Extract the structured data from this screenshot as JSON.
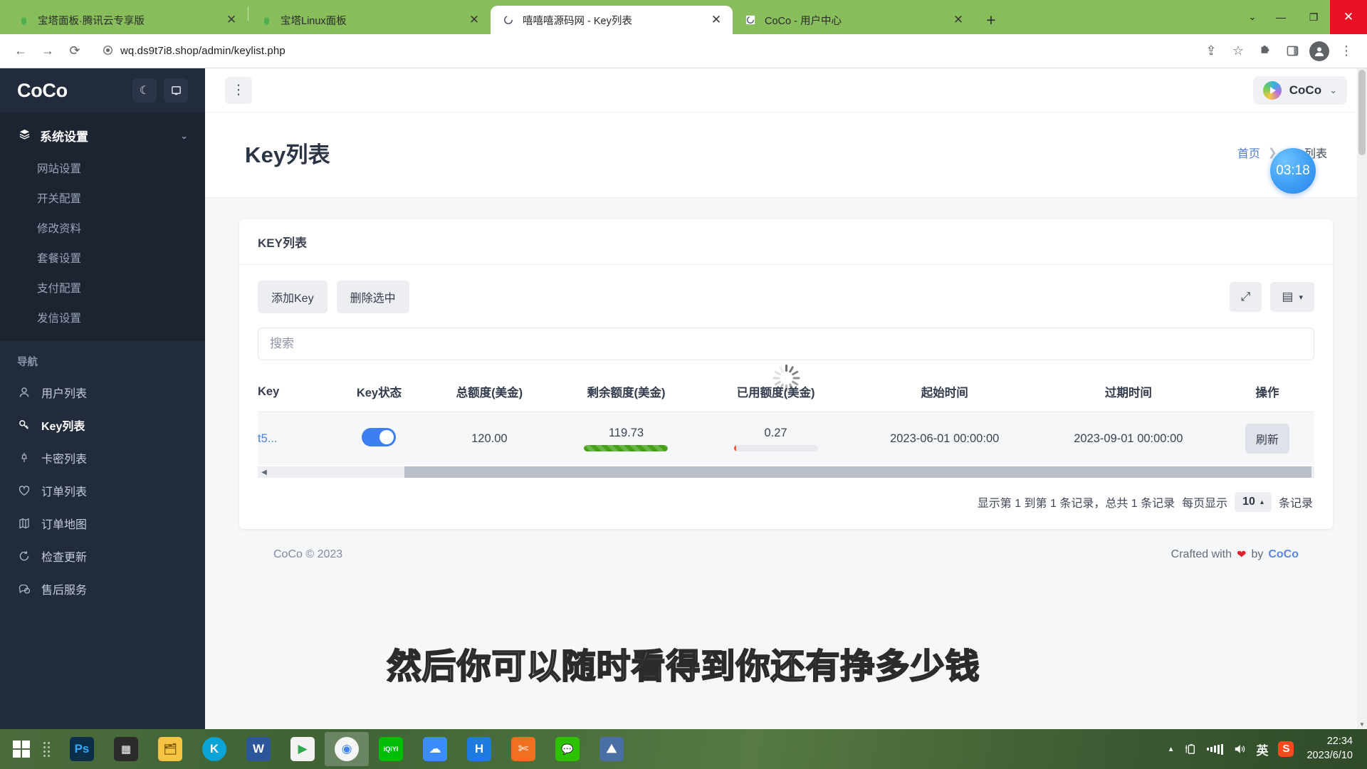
{
  "browser": {
    "tabs": [
      {
        "title": "宝塔面板·腾讯云专享版",
        "favicon": "bt-panel-icon",
        "active": false
      },
      {
        "title": "宝塔Linux面板",
        "favicon": "bt-panel-icon",
        "active": false
      },
      {
        "title": "嘻嘻嘻源码网 - Key列表",
        "favicon": "loading-icon",
        "active": true
      },
      {
        "title": "CoCo - 用户中心",
        "favicon": "loading-icon",
        "active": false
      }
    ],
    "new_tab_label": "+",
    "tab_close_label": "✕",
    "tab_list_chevron": "⌄",
    "window_minimize": "—",
    "window_maximize": "❐",
    "window_close": "✕",
    "nav": {
      "back": "←",
      "forward": "→",
      "reload": "⟳",
      "lock_icon": "●",
      "url": "wq.ds9t7i8.shop/admin/keylist.php",
      "share_icon": "⇪",
      "bookmark_icon": "☆",
      "extensions_icon": "🧩",
      "sidepanel_icon": "▯",
      "profile_icon": "👤",
      "menu_icon": "⋮"
    }
  },
  "sidebar": {
    "brand": "CoCo",
    "theme_toggle_icon": "☾",
    "layout_toggle_icon": "▣",
    "group": {
      "label": "系统设置",
      "icon": "layers-icon",
      "caret": "⌄",
      "items": [
        {
          "label": "网站设置"
        },
        {
          "label": "开关配置"
        },
        {
          "label": "修改资料"
        },
        {
          "label": "套餐设置"
        },
        {
          "label": "支付配置"
        },
        {
          "label": "发信设置"
        }
      ]
    },
    "nav_label": "导航",
    "nav_items": [
      {
        "label": "用户列表",
        "icon": "user-icon",
        "active": false
      },
      {
        "label": "Key列表",
        "icon": "key-icon",
        "active": true
      },
      {
        "label": "卡密列表",
        "icon": "pin-icon",
        "active": false
      },
      {
        "label": "订单列表",
        "icon": "heart-icon",
        "active": false
      },
      {
        "label": "订单地图",
        "icon": "map-icon",
        "active": false
      },
      {
        "label": "检查更新",
        "icon": "refresh-circle-icon",
        "active": false
      },
      {
        "label": "售后服务",
        "icon": "chat-icon",
        "active": false
      }
    ]
  },
  "topbar": {
    "kebab_icon": "⋮",
    "user_name": "CoCo",
    "user_caret": "⌄"
  },
  "page": {
    "title": "Key列表",
    "breadcrumb_home": "首页",
    "breadcrumb_sep": "❯",
    "breadcrumb_current": "Key列表",
    "float_badge": "03:18"
  },
  "card": {
    "title": "KEY列表",
    "buttons": {
      "add_key": "添加Key",
      "delete_selected": "删除选中"
    },
    "fullscreen_icon": "⤢",
    "columns_icon": "▤",
    "columns_caret": "▾",
    "search_placeholder": "搜索"
  },
  "table": {
    "columns": [
      "Key",
      "Key状态",
      "总额度(美金)",
      "剩余额度(美金)",
      "已用额度(美金)",
      "起始时间",
      "过期时间",
      "操作"
    ],
    "rows": [
      {
        "key": "t5...",
        "status_on": true,
        "total": "120.00",
        "remaining": "119.73",
        "remaining_pct": 100,
        "used": "0.27",
        "used_pct": 2,
        "start_time": "2023-06-01 00:00:00",
        "expire_time": "2023-09-01 00:00:00",
        "action": "刷新"
      }
    ],
    "scroll_left_arrow": "◀",
    "scroll_right_arrow": "▶"
  },
  "pagination": {
    "summary": "显示第 1 到第 1 条记录，总共 1 条记录",
    "per_page_label": "每页显示",
    "per_page_value": "10",
    "per_page_caret": "▴",
    "records_suffix": "条记录"
  },
  "footer": {
    "copyright": "CoCo © 2023",
    "crafted_prefix": "Crafted with",
    "heart": "❤",
    "crafted_by": "by",
    "crafted_author": "CoCo"
  },
  "subtitle": "然后你可以随时看得到你还有挣多少钱",
  "taskbar": {
    "apps": [
      {
        "name": "photoshop",
        "label": "Ps",
        "color": "#0b2f4a",
        "text_color": "#31a8ff",
        "selected": false
      },
      {
        "name": "editor",
        "label": "▦",
        "color": "#2b2b2b",
        "text_color": "#ffffff",
        "selected": false
      },
      {
        "name": "file-explorer",
        "label": "🗂",
        "color": "#f6c343",
        "text_color": "#7a5a00",
        "selected": false
      },
      {
        "name": "kugou",
        "label": "K",
        "color": "#0aa4d6",
        "text_color": "#ffffff",
        "selected": false
      },
      {
        "name": "word",
        "label": "W",
        "color": "#2b579a",
        "text_color": "#ffffff",
        "selected": false
      },
      {
        "name": "media-player",
        "label": "▶",
        "color": "#f2f2f2",
        "text_color": "#2fa84f",
        "selected": false
      },
      {
        "name": "chrome",
        "label": "◉",
        "color": "#f5f5f5",
        "text_color": "#4285f4",
        "selected": true
      },
      {
        "name": "iqiyi",
        "label": "iQIYI",
        "color": "#00be06",
        "text_color": "#ffffff",
        "selected": false
      },
      {
        "name": "baidu-netdisk",
        "label": "☁",
        "color": "#3b8cff",
        "text_color": "#ffffff",
        "selected": false
      },
      {
        "name": "huorong",
        "label": "H",
        "color": "#1f7ae0",
        "text_color": "#ffffff",
        "selected": false
      },
      {
        "name": "screenshot",
        "label": "✄",
        "color": "#f07020",
        "text_color": "#ffffff",
        "selected": false
      },
      {
        "name": "wechat",
        "label": "💬",
        "color": "#2dc100",
        "text_color": "#ffffff",
        "selected": false
      },
      {
        "name": "gallery",
        "label": "⛰",
        "color": "#4a6fa5",
        "text_color": "#ffffff",
        "selected": false
      }
    ],
    "tray": {
      "expand_icon": "▲",
      "battery_icon": "battery-icon",
      "network_icon": "signal-icon",
      "volume_icon": "🔊",
      "ime_icon": "英",
      "sogou_icon": "S"
    },
    "clock_time": "22:34",
    "clock_date": "2023/6/10"
  }
}
